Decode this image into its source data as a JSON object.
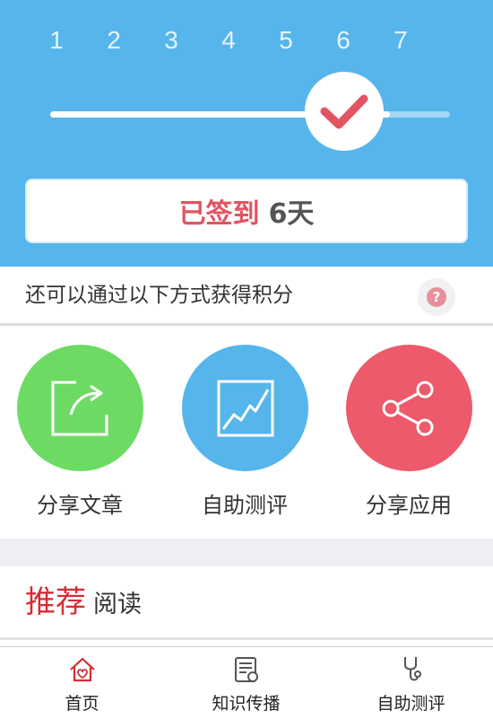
{
  "header": {
    "days": [
      "1",
      "2",
      "3",
      "4",
      "5",
      "6",
      "7"
    ],
    "progress_fraction": 0.85,
    "signed_label": "已签到",
    "signed_days": "6天",
    "marker_icon": "check-icon"
  },
  "points": {
    "text": "还可以通过以下方式获得积分",
    "help_glyph": "?"
  },
  "actions": [
    {
      "label": "分享文章",
      "icon": "share-article-icon",
      "color": "#6ddb63"
    },
    {
      "label": "自助测评",
      "icon": "chart-icon",
      "color": "#56b5eb"
    },
    {
      "label": "分享应用",
      "icon": "share-app-icon",
      "color": "#ec5a6b"
    }
  ],
  "recommend": {
    "strong": "推荐",
    "light": "阅读"
  },
  "nav": [
    {
      "label": "首页",
      "icon": "home-icon",
      "active": true
    },
    {
      "label": "知识传播",
      "icon": "document-icon",
      "active": false
    },
    {
      "label": "自助测评",
      "icon": "stethoscope-icon",
      "active": false
    }
  ],
  "colors": {
    "header_bg": "#56b5eb",
    "accent_red": "#e15461",
    "active_nav": "#d62b32"
  }
}
